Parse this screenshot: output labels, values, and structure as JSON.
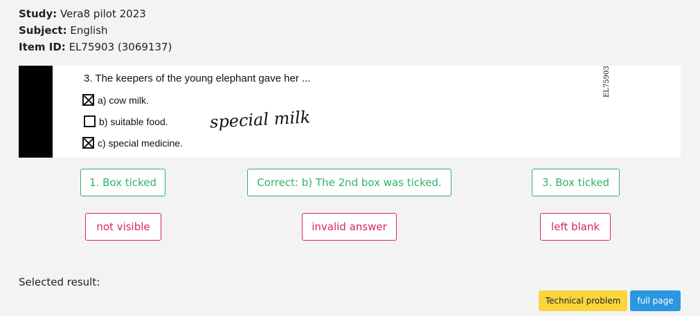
{
  "meta": {
    "study_label": "Study:",
    "study_value": " Vera8 pilot 2023",
    "subject_label": "Subject:",
    "subject_value": " English",
    "item_label": "Item ID:",
    "item_value": " EL75903 (3069137)"
  },
  "scan": {
    "question": "3. The keepers of the young elephant gave her ...",
    "option_a": "a) cow milk.",
    "option_b": "b) suitable food.",
    "option_c": "c) special medicine.",
    "handwriting": "special milk",
    "vertical_id": "EL75903"
  },
  "buttons": {
    "box1": "1. Box ticked",
    "correct": "Correct: b) The 2nd box was ticked.",
    "box3": "3. Box ticked",
    "not_visible": "not visible",
    "invalid": "invalid answer",
    "blank": "left blank"
  },
  "footer": {
    "selected_label": "Selected result:",
    "technical": "Technical problem",
    "full_page": "full page"
  },
  "colors": {
    "green": "#2eb268",
    "red": "#d6245c",
    "yellow": "#fbd53e",
    "blue": "#2c97df"
  }
}
